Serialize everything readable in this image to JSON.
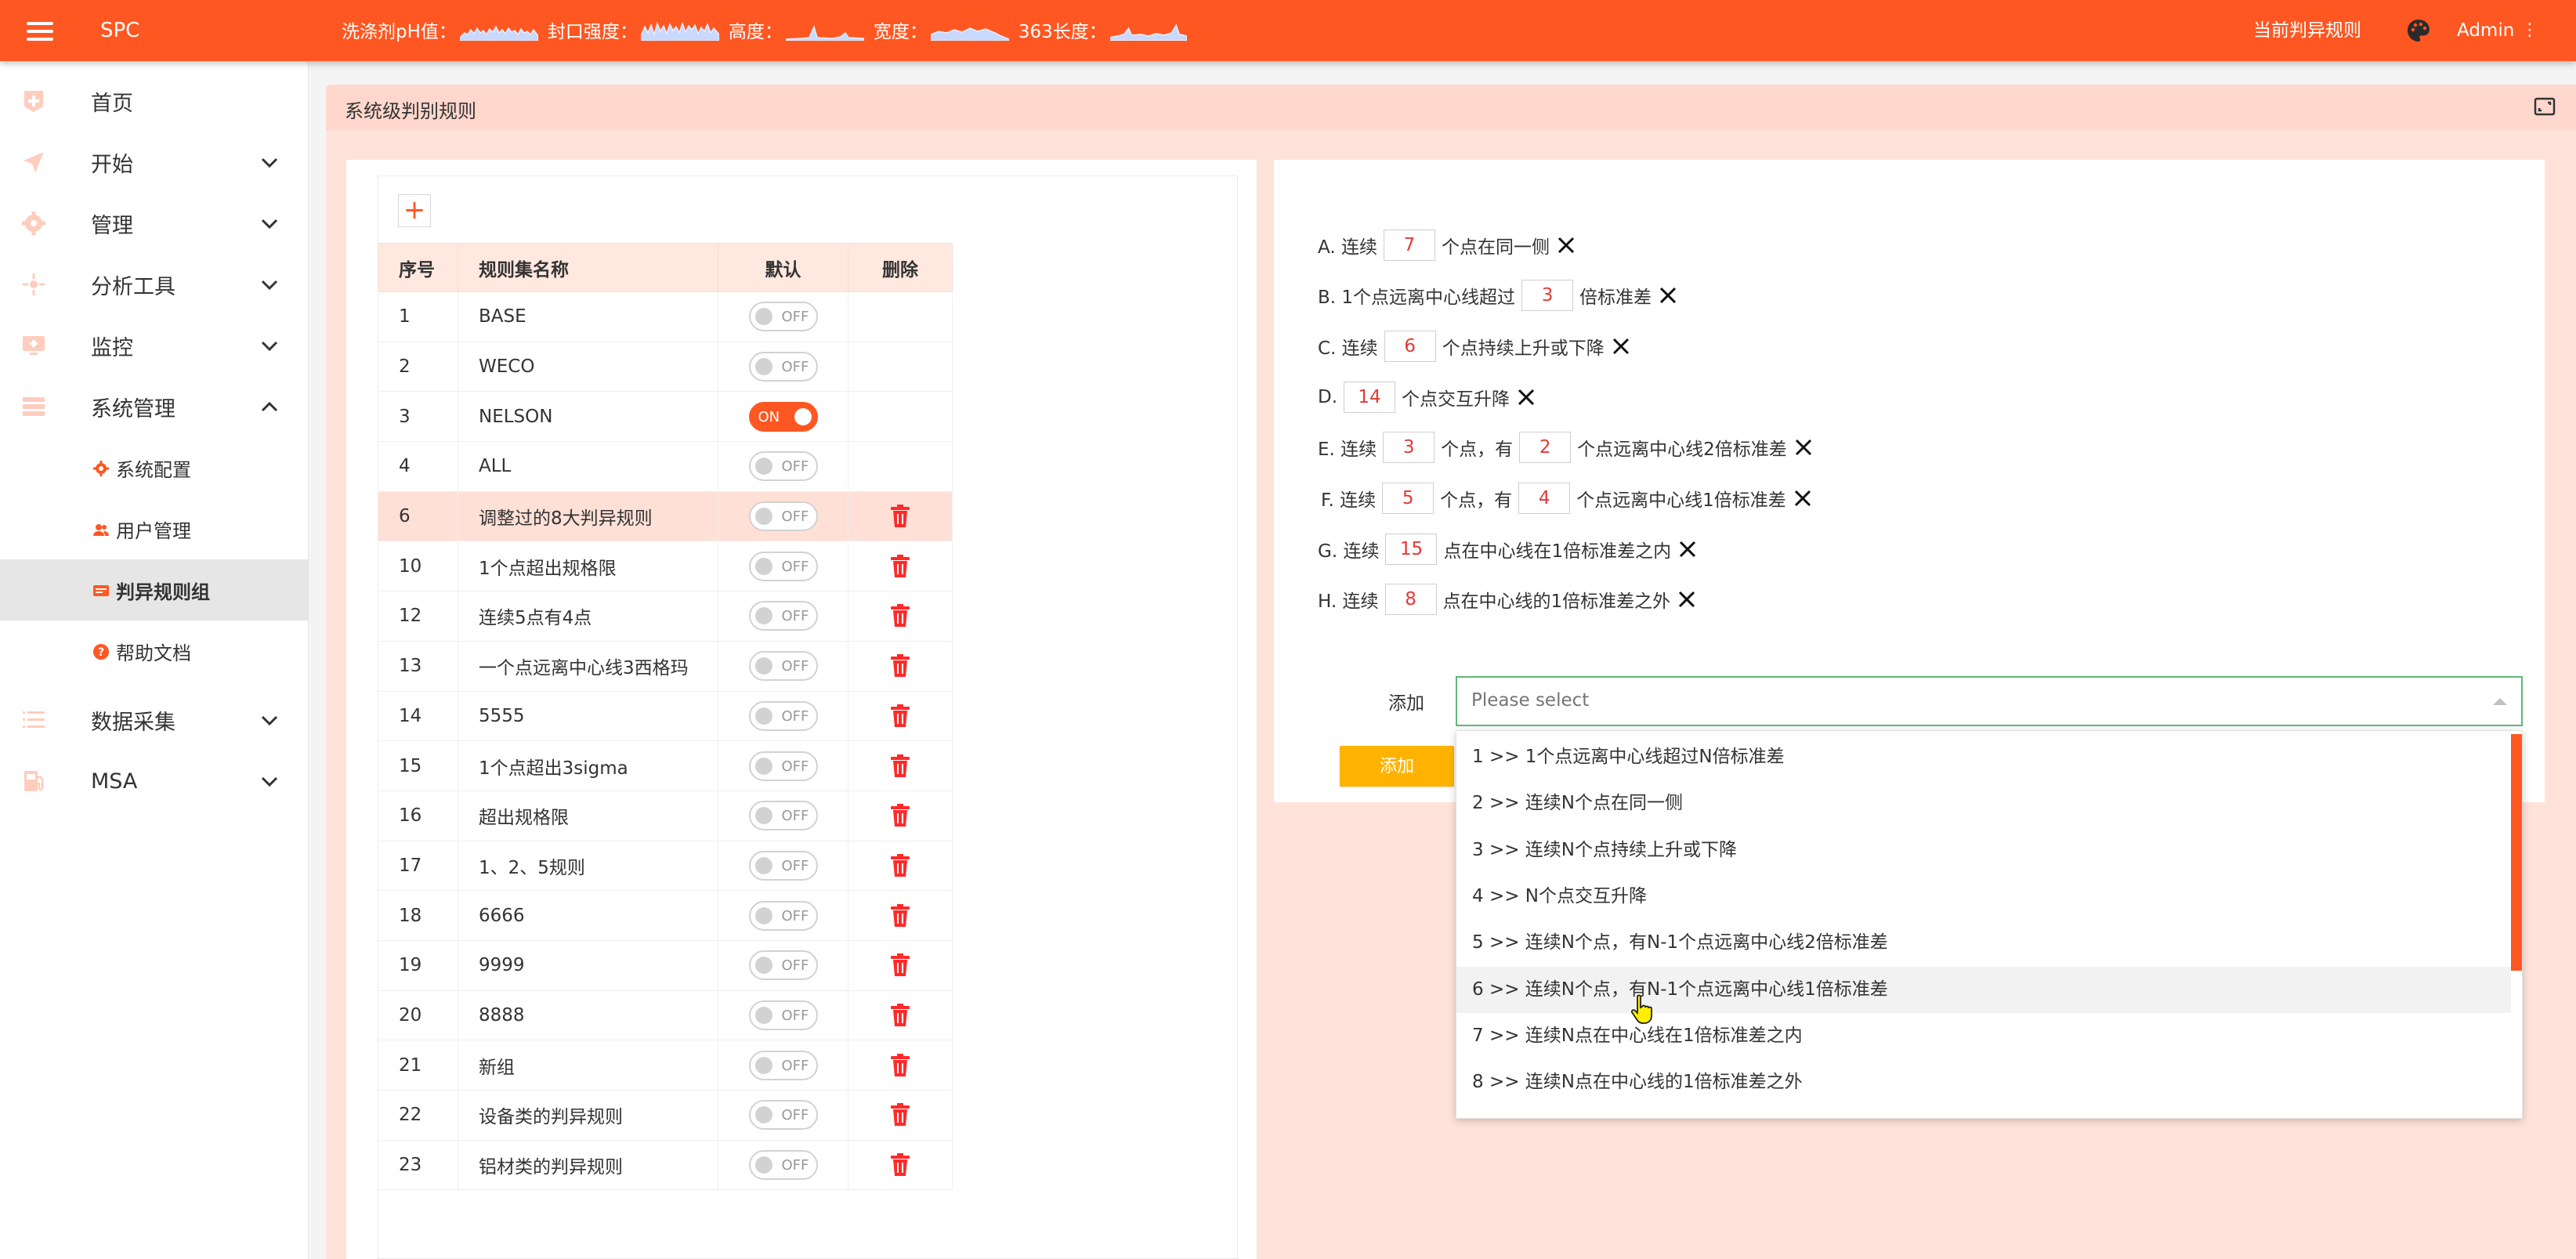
{
  "topbar": {
    "app_title": "SPC",
    "metrics": [
      "洗涤剂pH值：",
      "封口强度：",
      "高度：",
      "宽度：",
      "363长度："
    ],
    "right_link": "当前判异规则",
    "user": "Admin",
    "user_menu": "⋮"
  },
  "sidebar": {
    "items": [
      {
        "label": "首页",
        "icon": "home-icon"
      },
      {
        "label": "开始",
        "icon": "paper-plane-icon"
      },
      {
        "label": "管理",
        "icon": "gear-icon"
      },
      {
        "label": "分析工具",
        "icon": "analysis-icon"
      },
      {
        "label": "监控",
        "icon": "monitor-icon"
      },
      {
        "label": "系统管理",
        "icon": "server-icon"
      },
      {
        "label": "数据采集",
        "icon": "data-icon"
      },
      {
        "label": "MSA",
        "icon": "fuel-icon"
      }
    ],
    "subitems": [
      {
        "label": "系统配置",
        "icon": "gear-icon"
      },
      {
        "label": "用户管理",
        "icon": "users-icon"
      },
      {
        "label": "判异规则组",
        "icon": "card-icon"
      },
      {
        "label": "帮助文档",
        "icon": "help-icon"
      }
    ]
  },
  "panel": {
    "title": "系统级判别规则"
  },
  "table": {
    "headers": [
      "序号",
      "规则集名称",
      "默认",
      "删除"
    ],
    "toggle_off": "OFF",
    "toggle_on": "ON",
    "rows": [
      {
        "id": "1",
        "name": "BASE",
        "default": false,
        "deletable": false
      },
      {
        "id": "2",
        "name": "WECO",
        "default": false,
        "deletable": false
      },
      {
        "id": "3",
        "name": "NELSON",
        "default": true,
        "deletable": false
      },
      {
        "id": "4",
        "name": "ALL",
        "default": false,
        "deletable": false
      },
      {
        "id": "6",
        "name": "调整过的8大判异规则",
        "default": false,
        "deletable": true
      },
      {
        "id": "10",
        "name": "1个点超出规格限",
        "default": false,
        "deletable": true
      },
      {
        "id": "12",
        "name": "连续5点有4点",
        "default": false,
        "deletable": true
      },
      {
        "id": "13",
        "name": "一个点远离中心线3西格玛",
        "default": false,
        "deletable": true
      },
      {
        "id": "14",
        "name": "5555",
        "default": false,
        "deletable": true
      },
      {
        "id": "15",
        "name": "1个点超出3sigma",
        "default": false,
        "deletable": true
      },
      {
        "id": "16",
        "name": "超出规格限",
        "default": false,
        "deletable": true
      },
      {
        "id": "17",
        "name": "1、2、5规则",
        "default": false,
        "deletable": true
      },
      {
        "id": "18",
        "name": "6666",
        "default": false,
        "deletable": true
      },
      {
        "id": "19",
        "name": "9999",
        "default": false,
        "deletable": true
      },
      {
        "id": "20",
        "name": "8888",
        "default": false,
        "deletable": true
      },
      {
        "id": "21",
        "name": "新组",
        "default": false,
        "deletable": true
      },
      {
        "id": "22",
        "name": "设备类的判异规则",
        "default": false,
        "deletable": true
      },
      {
        "id": "23",
        "name": "铝材类的判异规则",
        "default": false,
        "deletable": true
      }
    ]
  },
  "rules": [
    {
      "parts": [
        "A. 连续",
        "7",
        "个点在同一侧"
      ]
    },
    {
      "parts": [
        "B. 1个点远离中心线超过",
        "3",
        "倍标准差"
      ]
    },
    {
      "parts": [
        "C. 连续",
        "6",
        "个点持续上升或下降"
      ]
    },
    {
      "parts": [
        "D.",
        "14",
        "个点交互升降"
      ]
    },
    {
      "parts": [
        "E. 连续",
        "3",
        "个点，有",
        "2",
        "个点远离中心线2倍标准差"
      ]
    },
    {
      "parts": [
        "F. 连续",
        "5",
        "个点，有",
        "4",
        "个点远离中心线1倍标准差"
      ]
    },
    {
      "parts": [
        "G. 连续",
        "15",
        "点在中心线在1倍标准差之内"
      ]
    },
    {
      "parts": [
        "H. 连续",
        "8",
        "点在中心线的1倍标准差之外"
      ]
    }
  ],
  "add_form": {
    "label": "添加",
    "placeholder": "Please select",
    "submit": "添加",
    "options": [
      "1 >> 1个点远离中心线超过N倍标准差",
      "2 >> 连续N个点在同一侧",
      "3 >> 连续N个点持续上升或下降",
      "4 >> N个点交互升降",
      "5 >> 连续N个点，有N-1个点远离中心线2倍标准差",
      "6 >> 连续N个点，有N-1个点远离中心线1倍标准差",
      "7 >> 连续N点在中心线在1倍标准差之内",
      "8 >> 连续N点在中心线的1倍标准差之外"
    ],
    "hovered_option": 5
  },
  "colors": {
    "accent": "#ff5722",
    "submit": "#ffb300",
    "danger": "#ff2a2a",
    "focus": "#5fb878"
  }
}
